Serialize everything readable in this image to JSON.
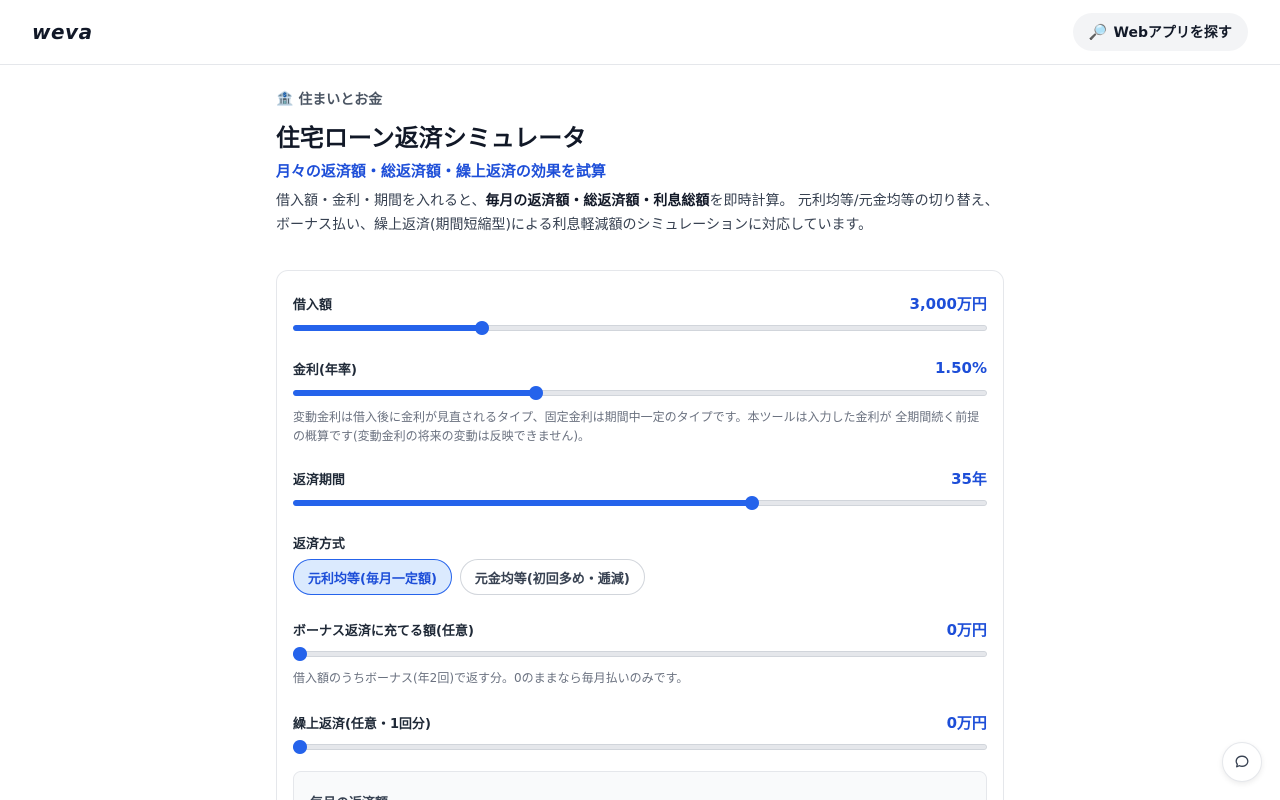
{
  "header": {
    "logo": "weva",
    "find_apps_icon": "magnifier-icon",
    "find_apps_label": "Webアプリを探す"
  },
  "page": {
    "category_icon": "bank-icon",
    "category": "住まいとお金",
    "title": "住宅ローン返済シミュレータ",
    "subtitle": "月々の返済額・総返済額・繰上返済の効果を試算",
    "desc_part1": "借入額・金利・期間を入れると、",
    "desc_bold": "毎月の返済額・総返済額・利息総額",
    "desc_part2": "を即時計算。 元利均等/元金均等の切り替え、ボーナス払い、繰上返済(期間短縮型)による利息軽減額のシミュレーションに対応しています。"
  },
  "form": {
    "loan": {
      "label": "借入額",
      "value": "3,000万円",
      "fraction": 0.268
    },
    "rate": {
      "label": "金利(年率)",
      "value": "1.50%",
      "fraction": 0.347,
      "hint": "変動金利は借入後に金利が見直されるタイプ、固定金利は期間中一定のタイプです。本ツールは入力した金利が 全期間続く前提の概算です(変動金利の将来の変動は反映できません)。"
    },
    "term": {
      "label": "返済期間",
      "value": "35年",
      "fraction": 0.664
    },
    "method": {
      "label": "返済方式",
      "options": [
        "元利均等(毎月一定額)",
        "元金均等(初回多め・逓減)"
      ],
      "selected_index": 0
    },
    "bonus": {
      "label": "ボーナス返済に充てる額(任意)",
      "value": "0万円",
      "fraction": 0,
      "hint": "借入額のうちボーナス(年2回)で返す分。0のままなら毎月払いのみです。"
    },
    "prepay": {
      "label": "繰上返済(任意・1回分)",
      "value": "0万円",
      "fraction": 0
    }
  },
  "result": {
    "monthly_label": "毎月の返済額"
  },
  "colors": {
    "accent": "#2563eb",
    "accent_text": "#1d4ed8"
  },
  "chat": {
    "icon": "chat-bubble-icon"
  }
}
